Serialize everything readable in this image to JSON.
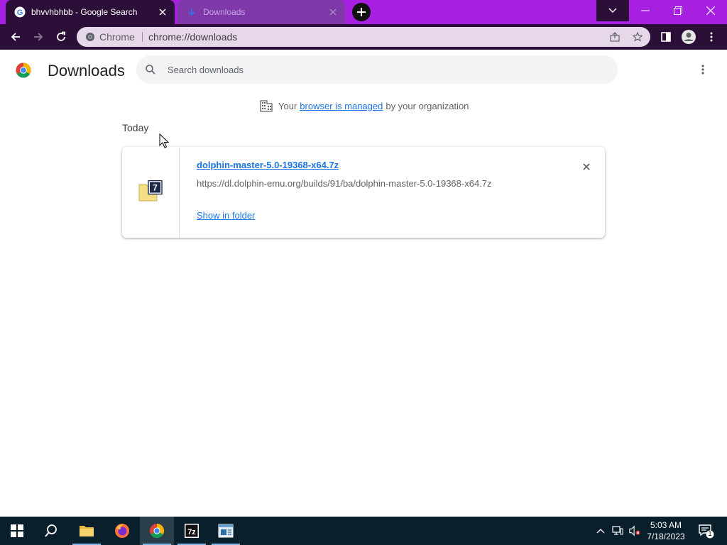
{
  "tabs": [
    {
      "title": "bhvvhbhbb - Google Search",
      "active": true
    },
    {
      "title": "Downloads",
      "active": false
    }
  ],
  "omnibox": {
    "site_label": "Chrome",
    "url": "chrome://downloads"
  },
  "page": {
    "title": "Downloads",
    "search_placeholder": "Search downloads",
    "managed": {
      "prefix": "Your",
      "link": "browser is managed",
      "suffix": "by your organization"
    },
    "section_label": "Today",
    "download": {
      "file_name": "dolphin-master-5.0-19368-x64.7z",
      "url": "https://dl.dolphin-emu.org/builds/91/ba/dolphin-master-5.0-19368-x64.7z",
      "action": "Show in folder",
      "icon_label": "7"
    }
  },
  "taskbar": {
    "apps": [
      "start-icon",
      "search-icon",
      "file-explorer-icon",
      "firefox-icon",
      "chrome-icon",
      "7zip-icon",
      "app-window-icon"
    ],
    "time": "5:03 AM",
    "date": "7/18/2023",
    "notification_count": "1"
  },
  "colors": {
    "tabstrip": "#a71fe0",
    "toolbar": "#2b0f38",
    "link": "#1a73e8",
    "taskbar": "#0a1f2c"
  }
}
